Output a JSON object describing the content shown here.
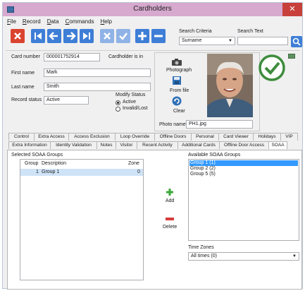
{
  "window": {
    "title": "Cardholders",
    "close_glyph": "✕"
  },
  "menu": [
    "File",
    "Record",
    "Data",
    "Commands",
    "Help"
  ],
  "search": {
    "criteria_label": "Search Criteria",
    "criteria_value": "Surname",
    "text_label": "Search Text",
    "text_value": ""
  },
  "form": {
    "card_number_label": "Card number",
    "card_number_value": "000001752914",
    "cardholder_in_label": "Cardholder is in",
    "first_name_label": "First name",
    "first_name_value": "Mark",
    "last_name_label": "Last name",
    "last_name_value": "Smith",
    "record_status_label": "Record status",
    "record_status_value": "Active",
    "modify_status_label": "Modify Status",
    "option_active": "Active",
    "option_invalid": "Invalid/Lost"
  },
  "photo": {
    "photograph_label": "Photograph",
    "from_file_label": "From file",
    "clear_label": "Clear",
    "photo_name_label": "Photo name",
    "photo_name_value": "PH1.jpg"
  },
  "tabs_row1": [
    "Control",
    "Extra Access",
    "Access Exclusion",
    "Loop Override",
    "Offline Doors",
    "Personal",
    "Card Viewer",
    "Holidays",
    "VIP"
  ],
  "tabs_row2": [
    "Extra Information",
    "Identity Validation",
    "Notes",
    "Visitor",
    "Recent Activity",
    "Additional Cards",
    "Offline Door Access",
    "SOAA"
  ],
  "soaa": {
    "selected_label": "Selected SOAA Groups",
    "col_group": "Group",
    "col_description": "Description",
    "col_zone": "Zone",
    "rows": [
      {
        "group": "1",
        "description": "Group 1",
        "zone": "0"
      }
    ],
    "available_label": "Available SOAA Groups",
    "available": [
      "Group 1 (1)",
      "Group 2 (2)",
      "Group 5 (5)"
    ],
    "add_label": "Add",
    "delete_label": "Delete",
    "time_zones_label": "Time Zones",
    "time_zones_value": "All times (0)"
  },
  "colors": {
    "titlebar": "#d7a9cf",
    "accent_blue": "#3e7ed6",
    "valid_green": "#3d8c3d",
    "close_red": "#c7413a"
  },
  "icons": [
    "app-icon",
    "close-icon",
    "delete-record-icon",
    "first-record-icon",
    "previous-record-icon",
    "next-record-icon",
    "last-record-icon",
    "cancel-icon",
    "confirm-icon",
    "add-record-icon",
    "remove-record-icon",
    "search-icon",
    "valid-check-icon",
    "camera-icon",
    "folder-icon",
    "clear-icon",
    "add-icon",
    "delete-icon"
  ]
}
